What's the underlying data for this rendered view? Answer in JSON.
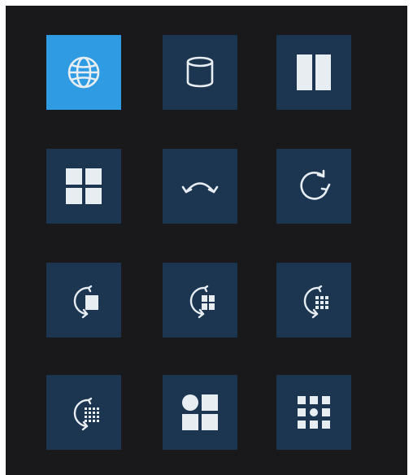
{
  "toolbar": {
    "buttons": [
      {
        "icon": "globe-icon",
        "state": "selected"
      },
      {
        "icon": "cylinder-icon"
      },
      {
        "icon": "two-panel-split-icon"
      },
      {
        "icon": "four-grid-icon"
      },
      {
        "icon": "flip-arrow-icon"
      },
      {
        "icon": "rotate-icon"
      },
      {
        "icon": "rotate-single-block-icon"
      },
      {
        "icon": "rotate-four-block-icon"
      },
      {
        "icon": "rotate-nine-dot-icon"
      },
      {
        "icon": "rotate-sixteen-dot-icon"
      },
      {
        "icon": "circle-and-blocks-icon"
      },
      {
        "icon": "dotted-grid-icon"
      }
    ]
  },
  "colors": {
    "panel_background": "#19191b",
    "button_background": "#1c3652",
    "button_selected": "#2e9be3",
    "icon": "#e8edf2"
  }
}
